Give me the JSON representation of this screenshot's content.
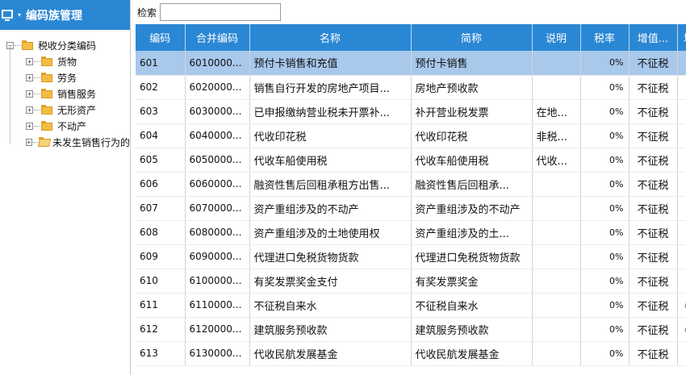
{
  "sidebar": {
    "title": "编码族管理",
    "tree": {
      "root": "税收分类编码",
      "children": [
        "货物",
        "劳务",
        "销售服务",
        "无形资产",
        "不动产",
        "未发生销售行为的"
      ]
    }
  },
  "search": {
    "label": "检索",
    "value": ""
  },
  "table": {
    "columns": [
      "编码",
      "合并编码",
      "名称",
      "简称",
      "说明",
      "税率",
      "增值...",
      "增"
    ],
    "rows": [
      {
        "code": "601",
        "merged": "6010000...",
        "name": "预付卡销售和充值",
        "short": "预付卡销售",
        "desc": "",
        "rate": "0%",
        "vat": "不征税",
        "extra": "",
        "selected": true
      },
      {
        "code": "602",
        "merged": "6020000...",
        "name": "销售自行开发的房地产项目...",
        "short": "房地产预收款",
        "desc": "",
        "rate": "0%",
        "vat": "不征税",
        "extra": ""
      },
      {
        "code": "603",
        "merged": "6030000...",
        "name": "已申报缴纳营业税未开票补...",
        "short": "补开营业税发票",
        "desc": "在地...",
        "rate": "0%",
        "vat": "不征税",
        "extra": ""
      },
      {
        "code": "604",
        "merged": "6040000...",
        "name": "代收印花税",
        "short": "代收印花税",
        "desc": "非税...",
        "rate": "0%",
        "vat": "不征税",
        "extra": ""
      },
      {
        "code": "605",
        "merged": "6050000...",
        "name": "代收车船使用税",
        "short": "代收车船使用税",
        "desc": "代收...",
        "rate": "0%",
        "vat": "不征税",
        "extra": ""
      },
      {
        "code": "606",
        "merged": "6060000...",
        "name": "融资性售后回租承租方出售...",
        "short": "融资性售后回租承...",
        "desc": "",
        "rate": "0%",
        "vat": "不征税",
        "extra": ""
      },
      {
        "code": "607",
        "merged": "6070000...",
        "name": "资产重组涉及的不动产",
        "short": "资产重组涉及的不动产",
        "desc": "",
        "rate": "0%",
        "vat": "不征税",
        "extra": ""
      },
      {
        "code": "608",
        "merged": "6080000...",
        "name": "资产重组涉及的土地使用权",
        "short": "资产重组涉及的土...",
        "desc": "",
        "rate": "0%",
        "vat": "不征税",
        "extra": ""
      },
      {
        "code": "609",
        "merged": "6090000...",
        "name": "代理进口免税货物货款",
        "short": "代理进口免税货物货款",
        "desc": "",
        "rate": "0%",
        "vat": "不征税",
        "extra": ""
      },
      {
        "code": "610",
        "merged": "6100000...",
        "name": "有奖发票奖金支付",
        "short": "有奖发票奖金",
        "desc": "",
        "rate": "0%",
        "vat": "不征税",
        "extra": ""
      },
      {
        "code": "611",
        "merged": "6110000...",
        "name": "不征税自来水",
        "short": "不征税自来水",
        "desc": "",
        "rate": "0%",
        "vat": "不征税",
        "extra": "《"
      },
      {
        "code": "612",
        "merged": "6120000...",
        "name": "建筑服务预收款",
        "short": "建筑服务预收款",
        "desc": "",
        "rate": "0%",
        "vat": "不征税",
        "extra": "《"
      },
      {
        "code": "613",
        "merged": "6130000...",
        "name": "代收民航发展基金",
        "short": "代收民航发展基金",
        "desc": "",
        "rate": "0%",
        "vat": "不征税",
        "extra": ""
      }
    ]
  }
}
